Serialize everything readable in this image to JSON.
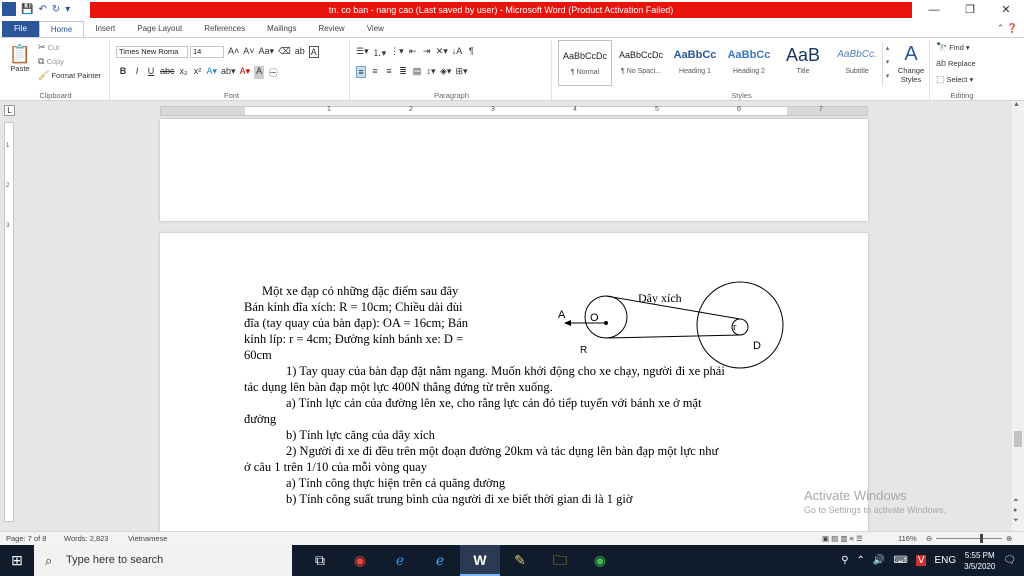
{
  "window": {
    "title": "tn. co ban - nang cao (Last saved by user) - Microsoft Word (Product Activation Failed)",
    "minimize": "—",
    "restore": "❐",
    "close": "✕"
  },
  "tabs": [
    {
      "label": "File"
    },
    {
      "label": "Home"
    },
    {
      "label": "Insert"
    },
    {
      "label": "Page Layout"
    },
    {
      "label": "References"
    },
    {
      "label": "Mailings"
    },
    {
      "label": "Review"
    },
    {
      "label": "View"
    }
  ],
  "clipboard": {
    "cut": "Cut",
    "copy": "Copy",
    "paste": "Paste",
    "format_painter": "Format Painter",
    "label": "Clipboard"
  },
  "font": {
    "family": "Times New Roma",
    "size": "14",
    "label": "Font"
  },
  "paragraph": {
    "label": "Paragraph"
  },
  "styles": {
    "label": "Styles",
    "items": [
      {
        "preview": "AaBbCcDc",
        "name": "¶ Normal"
      },
      {
        "preview": "AaBbCcDc",
        "name": "¶ No Spaci..."
      },
      {
        "preview": "AaBbCc",
        "name": "Heading 1"
      },
      {
        "preview": "AaBbCc",
        "name": "Heading 2"
      },
      {
        "preview": "AaB",
        "name": "Title"
      },
      {
        "preview": "AaBbCc.",
        "name": "Subtitle"
      }
    ],
    "change_styles": "Change Styles"
  },
  "editing": {
    "find": "Find",
    "replace": "Replace",
    "select": "Select",
    "label": "Editing"
  },
  "ruler": {
    "numbers": [
      "1",
      "2",
      "3",
      "4",
      "5",
      "6",
      "7"
    ],
    "v_numbers": [
      "1",
      "2",
      "3"
    ]
  },
  "document": {
    "lines": [
      {
        "text": "Một xe đạp có những đặc điểm sau đây",
        "indent": 1
      },
      {
        "text": "Bán kính đĩa xích: R = 10cm; Chiều dài đùi",
        "indent": 0
      },
      {
        "text": "đĩa (tay quay của bàn đạp): OA = 16cm; Bán",
        "indent": 0
      },
      {
        "text": "kính líp: r = 4cm; Đường kính bánh xe: D =",
        "indent": 0
      },
      {
        "text": "60cm",
        "indent": 0
      },
      {
        "text": "1) Tay quay của bàn đạp đặt nằm ngang. Muốn khởi động cho xe chạy, người đi xe phải",
        "indent": 2
      },
      {
        "text": "tác dụng lên bàn đạp một lực 400N thẳng đứng từ trên xuống.",
        "indent": 0
      },
      {
        "text": "a) Tính lực cản của đường lên xe, cho rằng lực cản đó tiếp tuyến với bánh xe ở mặt",
        "indent": 2
      },
      {
        "text": "đường",
        "indent": 0
      },
      {
        "text": "b) Tính lực căng của dây xích",
        "indent": 2
      },
      {
        "text": "2) Người đi xe đi đều trên một đoạn đường 20km và tác dụng lên bàn đạp một lực như",
        "indent": 2
      },
      {
        "text": "ở câu 1 trên 1/10 của mỗi vòng quay",
        "indent": 0
      },
      {
        "text": "a) Tính công thực hiện trên cả quãng đường",
        "indent": 2
      },
      {
        "text": "b) Tính công suất trung bình của người đi xe biết thời gian đi là 1 giờ",
        "indent": 2
      }
    ],
    "diagram": {
      "chain_label": "Dây xích",
      "a": "A",
      "o": "O",
      "r_big": "R",
      "r_small": "r",
      "d": "D"
    }
  },
  "watermark": {
    "title": "Activate Windows",
    "subtitle": "Go to Settings to activate Windows."
  },
  "status": {
    "page": "Page: 7 of 8",
    "words": "Words: 2,823",
    "language": "Vietnamese",
    "zoom": "116%"
  },
  "taskbar": {
    "search_placeholder": "Type here to search",
    "language": "ENG",
    "time": "5:55 PM",
    "date": "3/5/2020"
  }
}
